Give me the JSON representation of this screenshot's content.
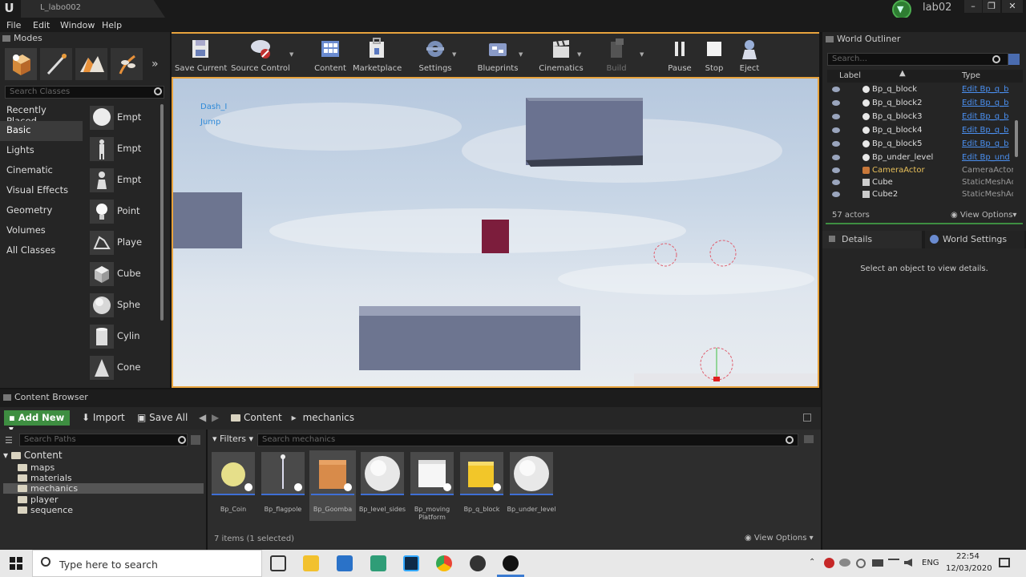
{
  "window": {
    "doc_tab": "L_labo002",
    "project_name": "lab02",
    "minimize": "–",
    "restore": "❐",
    "close": "✕"
  },
  "menu": [
    "File",
    "Edit",
    "Window",
    "Help"
  ],
  "modes": {
    "tab_label": "Modes",
    "search_placeholder": "Search Classes",
    "categories": [
      "Recently Placed",
      "Basic",
      "Lights",
      "Cinematic",
      "Visual Effects",
      "Geometry",
      "Volumes",
      "All Classes"
    ],
    "active_category": "Basic",
    "items": [
      "Empt",
      "Empt",
      "Empt",
      "Point",
      "Playe",
      "Cube",
      "Sphe",
      "Cylin",
      "Cone"
    ]
  },
  "toolbar": {
    "buttons": [
      "Save Current",
      "Source Control",
      "Content",
      "Marketplace",
      "Settings",
      "Blueprints",
      "Cinematics",
      "Build",
      "Pause",
      "Stop",
      "Eject"
    ]
  },
  "viewport": {
    "debug_lines": [
      "Dash_I",
      "Jump"
    ]
  },
  "content_browser": {
    "tab_label": "Content Browser",
    "add_new": "Add New",
    "import": "Import",
    "save_all": "Save All",
    "breadcrumb": [
      "Content",
      "mechanics"
    ],
    "search_paths_placeholder": "Search Paths",
    "search_assets_placeholder": "Search mechanics",
    "filters": "Filters",
    "tree_root": "Content",
    "tree_folders": [
      "maps",
      "materials",
      "mechanics",
      "player",
      "sequence"
    ],
    "selected_folder": "mechanics",
    "assets": [
      {
        "label": "Bp_Coin",
        "color": "#e6df8a"
      },
      {
        "label": "Bp_flagpole",
        "color": "#cfd4d8"
      },
      {
        "label": "Bp_Goomba",
        "color": "#d88b4a"
      },
      {
        "label": "Bp_level_sides",
        "color": "#f2f2f2"
      },
      {
        "label": "Bp_moving Platform",
        "color": "#f6f6f6"
      },
      {
        "label": "Bp_q_block",
        "color": "#f2c629"
      },
      {
        "label": "Bp_under_level",
        "color": "#f2f2f2"
      }
    ],
    "selected_asset": "Bp_Goomba",
    "item_count": "7 items (1 selected)",
    "view_options": "View Options"
  },
  "outliner": {
    "tab_label": "World Outliner",
    "search_placeholder": "Search...",
    "col_label": "Label",
    "col_type": "Type",
    "rows": [
      {
        "name": "Bp_q_block",
        "type": "Edit Bp_q_b",
        "link": true
      },
      {
        "name": "Bp_q_block2",
        "type": "Edit Bp_q_b",
        "link": true
      },
      {
        "name": "Bp_q_block3",
        "type": "Edit Bp_q_b",
        "link": true
      },
      {
        "name": "Bp_q_block4",
        "type": "Edit Bp_q_b",
        "link": true
      },
      {
        "name": "Bp_q_block5",
        "type": "Edit Bp_q_b",
        "link": true
      },
      {
        "name": "Bp_under_level",
        "type": "Edit Bp_und",
        "link": true
      },
      {
        "name": "CameraActor",
        "type": "CameraActor",
        "link": false
      },
      {
        "name": "Cube",
        "type": "StaticMeshAc",
        "link": false
      },
      {
        "name": "Cube2",
        "type": "StaticMeshAc",
        "link": false
      }
    ],
    "actor_count": "57 actors",
    "view_options": "View Options"
  },
  "details": {
    "tab_details": "Details",
    "tab_world_settings": "World Settings",
    "empty_message": "Select an object to view details."
  },
  "taskbar": {
    "search_text": "Type here to search",
    "language": "ENG",
    "time": "22:54",
    "date": "12/03/2020"
  }
}
